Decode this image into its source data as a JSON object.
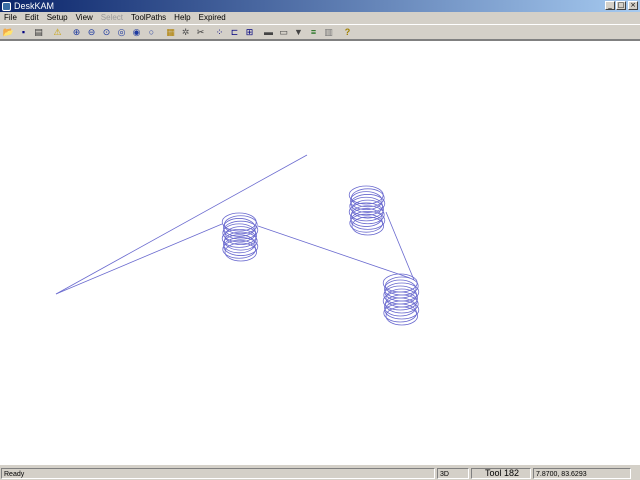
{
  "window": {
    "title": "DeskKAM",
    "minimize_glyph": "_",
    "maximize_glyph": "□",
    "close_glyph": "×"
  },
  "menu": {
    "items": [
      "File",
      "Edit",
      "Setup",
      "View",
      "Select",
      "ToolPaths",
      "Help",
      "Expired"
    ]
  },
  "toolbar": {
    "icons": [
      {
        "name": "open-icon",
        "glyph": "📂"
      },
      {
        "name": "save-icon",
        "glyph": "▪"
      },
      {
        "name": "print-icon",
        "glyph": "▤"
      },
      {
        "name": "warning-icon",
        "glyph": "⚠"
      },
      {
        "name": "zoom-in-icon",
        "glyph": "⊕"
      },
      {
        "name": "zoom-out-icon",
        "glyph": "⊖"
      },
      {
        "name": "zoom-window-icon",
        "glyph": "⊙"
      },
      {
        "name": "zoom-fit-icon",
        "glyph": "◎"
      },
      {
        "name": "zoom-previous-icon",
        "glyph": "◉"
      },
      {
        "name": "zoom-all-icon",
        "glyph": "○"
      },
      {
        "name": "layers-icon",
        "glyph": "▦"
      },
      {
        "name": "settings-icon",
        "glyph": "✲"
      },
      {
        "name": "cut-icon",
        "glyph": "✂"
      },
      {
        "name": "node-select-icon",
        "glyph": "⁘"
      },
      {
        "name": "node-connect-icon",
        "glyph": "⊏"
      },
      {
        "name": "node-group-icon",
        "glyph": "⊞"
      },
      {
        "name": "machine-icon",
        "glyph": "▬"
      },
      {
        "name": "machine-run-icon",
        "glyph": "▭"
      },
      {
        "name": "filter-icon",
        "glyph": "▼"
      },
      {
        "name": "list-icon",
        "glyph": "≡"
      },
      {
        "name": "grid-icon",
        "glyph": "▥"
      },
      {
        "name": "help-icon",
        "glyph": "?"
      }
    ]
  },
  "status": {
    "message": "Ready",
    "mode": "3D",
    "tool": "Tool 182",
    "coords": "7.8700, 83.6293"
  },
  "colors": {
    "toolpath": "#6a6acf",
    "titlebar_start": "#0a246a",
    "titlebar_end": "#a6caf0"
  }
}
